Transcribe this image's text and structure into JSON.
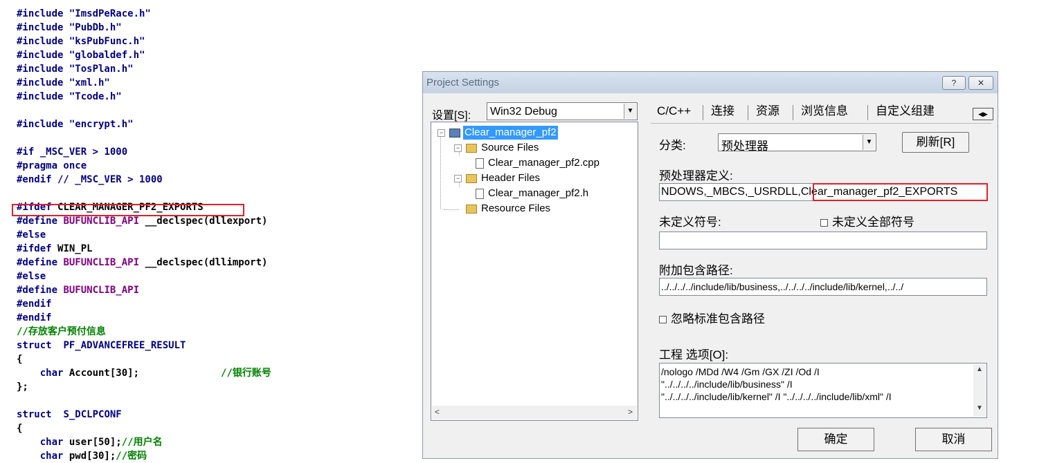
{
  "code": {
    "lines": [
      {
        "segs": [
          {
            "t": "#include ",
            "c": "kw"
          },
          {
            "t": "\"ImsdPeRace.h\"",
            "c": "str"
          }
        ]
      },
      {
        "segs": [
          {
            "t": "#include ",
            "c": "kw"
          },
          {
            "t": "\"PubDb.h\"",
            "c": "str"
          }
        ]
      },
      {
        "segs": [
          {
            "t": "#include ",
            "c": "kw"
          },
          {
            "t": "\"ksPubFunc.h\"",
            "c": "str"
          }
        ]
      },
      {
        "segs": [
          {
            "t": "#include ",
            "c": "kw"
          },
          {
            "t": "\"globaldef.h\"",
            "c": "str"
          }
        ]
      },
      {
        "segs": [
          {
            "t": "#include ",
            "c": "kw"
          },
          {
            "t": "\"TosPlan.h\"",
            "c": "str"
          }
        ]
      },
      {
        "segs": [
          {
            "t": "#include ",
            "c": "kw"
          },
          {
            "t": "\"xml.h\"",
            "c": "str"
          }
        ]
      },
      {
        "segs": [
          {
            "t": "#include ",
            "c": "kw"
          },
          {
            "t": "\"Tcode.h\"",
            "c": "str"
          }
        ]
      },
      {
        "segs": []
      },
      {
        "segs": [
          {
            "t": "#include ",
            "c": "kw"
          },
          {
            "t": "\"encrypt.h\"",
            "c": "str"
          }
        ]
      },
      {
        "segs": []
      },
      {
        "segs": [
          {
            "t": "#if _MSC_VER > 1000",
            "c": "kw"
          }
        ]
      },
      {
        "segs": [
          {
            "t": "#pragma once",
            "c": "kw"
          }
        ]
      },
      {
        "segs": [
          {
            "t": "#endif // _MSC_VER > 1000",
            "c": "kw"
          }
        ]
      },
      {
        "segs": []
      },
      {
        "segs": [
          {
            "t": "#ifdef ",
            "c": "kw"
          },
          {
            "t": "CLEAR_MANAGER_PF2_EXPORTS",
            "c": "plain"
          }
        ]
      },
      {
        "segs": [
          {
            "t": "#define ",
            "c": "kw"
          },
          {
            "t": "BUFUNCLIB_API",
            "c": "id"
          },
          {
            "t": " __declspec(dllexport)",
            "c": "plain"
          }
        ]
      },
      {
        "segs": [
          {
            "t": "#else",
            "c": "kw"
          }
        ]
      },
      {
        "segs": [
          {
            "t": "#ifdef ",
            "c": "kw"
          },
          {
            "t": "WIN_PL",
            "c": "plain"
          }
        ]
      },
      {
        "segs": [
          {
            "t": "#define ",
            "c": "kw"
          },
          {
            "t": "BUFUNCLIB_API",
            "c": "id"
          },
          {
            "t": " __declspec(dllimport)",
            "c": "plain"
          }
        ]
      },
      {
        "segs": [
          {
            "t": "#else",
            "c": "kw"
          }
        ]
      },
      {
        "segs": [
          {
            "t": "#define ",
            "c": "kw"
          },
          {
            "t": "BUFUNCLIB_API",
            "c": "id"
          }
        ]
      },
      {
        "segs": [
          {
            "t": "#endif",
            "c": "kw"
          }
        ]
      },
      {
        "segs": [
          {
            "t": "#endif",
            "c": "kw"
          }
        ]
      },
      {
        "segs": [
          {
            "t": "//存放客户预付信息",
            "c": "cm"
          }
        ]
      },
      {
        "segs": [
          {
            "t": "struct  ",
            "c": "kw"
          },
          {
            "t": "PF_ADVANCEFREE_RESULT",
            "c": "kw"
          }
        ]
      },
      {
        "segs": [
          {
            "t": "{",
            "c": "plain"
          }
        ]
      },
      {
        "segs": [
          {
            "t": "    char ",
            "c": "kw"
          },
          {
            "t": "Account[30];",
            "c": "plain"
          },
          {
            "t": "              //银行账号",
            "c": "cm"
          }
        ]
      },
      {
        "segs": [
          {
            "t": "};",
            "c": "plain"
          }
        ]
      },
      {
        "segs": []
      },
      {
        "segs": [
          {
            "t": "struct  ",
            "c": "kw"
          },
          {
            "t": "S_DCLPCONF",
            "c": "kw"
          }
        ]
      },
      {
        "segs": [
          {
            "t": "{",
            "c": "plain"
          }
        ]
      },
      {
        "segs": [
          {
            "t": "    char ",
            "c": "kw"
          },
          {
            "t": "user[50];",
            "c": "plain"
          },
          {
            "t": "//用户名",
            "c": "cm"
          }
        ]
      },
      {
        "segs": [
          {
            "t": "    char ",
            "c": "kw"
          },
          {
            "t": "pwd[30];",
            "c": "plain"
          },
          {
            "t": "//密码",
            "c": "cm"
          }
        ]
      }
    ]
  },
  "dialog": {
    "title": "Project Settings",
    "help_label": "?",
    "close_label": "✕",
    "settings_label": "设置[S]:",
    "settings_value": "Win32 Debug",
    "tree": {
      "project": "Clear_manager_pf2",
      "source_files": "Source Files",
      "source_file_1": "Clear_manager_pf2.cpp",
      "header_files": "Header Files",
      "header_file_1": "Clear_manager_pf2.h",
      "resource_files": "Resource Files"
    },
    "tabs": [
      "C/C++",
      "连接",
      "资源",
      "浏览信息",
      "自定义组建"
    ],
    "category_label": "分类:",
    "category_value": "预处理器",
    "refresh_label": "刷新[R]",
    "preproc_label": "预处理器定义:",
    "preproc_value": "NDOWS,_MBCS,_USRDLL,Clear_manager_pf2_EXPORTS",
    "undef_label": "未定义符号:",
    "undef_all_label": "未定义全部符号",
    "undef_value": "",
    "include_label": "附加包含路径:",
    "include_value": "../../../../include/lib/business,../../../../include/lib/kernel,../../",
    "ignore_std_label": "忽略标准包含路径",
    "options_label": "工程 选项[O]:",
    "options_lines": [
      "/nologo /MDd /W4 /Gm /GX /ZI /Od /I",
      "\"../../../../include/lib/business\" /I",
      "\"../../../../include/lib/kernel\" /I \"../../../../include/lib/xml\" /I"
    ],
    "ok_label": "确定",
    "cancel_label": "取消"
  }
}
